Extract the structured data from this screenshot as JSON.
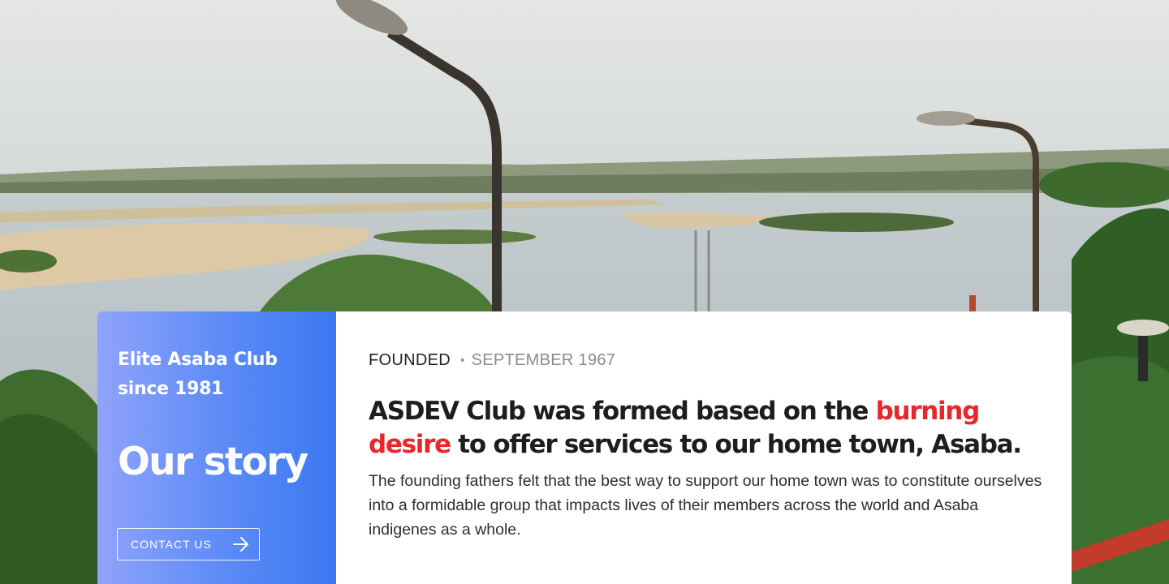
{
  "story_panel": {
    "tagline": "Elite Asaba Club since 1981",
    "title": "Our story",
    "contact_label": "CONTACT US"
  },
  "story_card": {
    "meta_label": "FOUNDED",
    "meta_date": "SEPTEMBER 1967",
    "headline_part1": "ASDEV Club was formed based on the ",
    "headline_highlight": "burning desire",
    "headline_part2": " to offer services to our home town, Asaba.",
    "body": "The founding fathers felt that the best way to support our home town was to constitute ourselves into a formidable group that impacts lives of their members across the world and Asaba indigenes as a whole."
  },
  "colors": {
    "highlight": "#e8262b",
    "gradient_start": "#8fa3fb",
    "gradient_end": "#3b78f2"
  },
  "icons": {
    "contact_arrow": "arrow-right-icon"
  }
}
